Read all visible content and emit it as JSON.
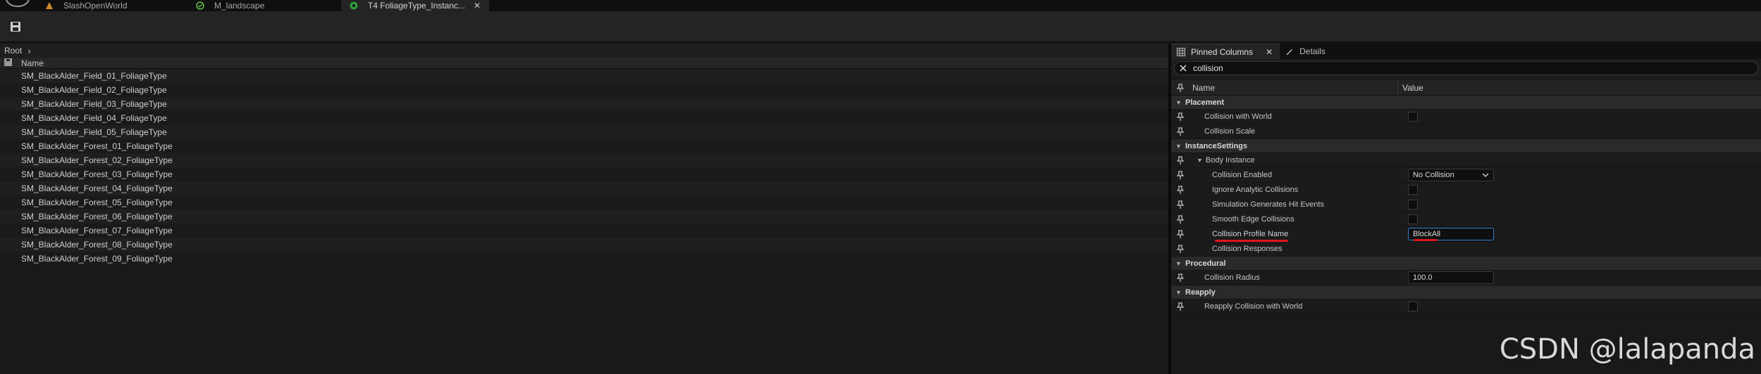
{
  "tabs": [
    {
      "label": "SlashOpenWorld",
      "icon": "level-icon",
      "active": false
    },
    {
      "label": "M_landscape",
      "icon": "material-icon",
      "active": false
    },
    {
      "label": "T4 FoliageType_Instanc...",
      "icon": "foliage-icon",
      "active": true
    }
  ],
  "breadcrumb": {
    "root": "Root"
  },
  "list": {
    "header": "Name",
    "items": [
      "SM_BlackAlder_Field_01_FoliageType",
      "SM_BlackAlder_Field_02_FoliageType",
      "SM_BlackAlder_Field_03_FoliageType",
      "SM_BlackAlder_Field_04_FoliageType",
      "SM_BlackAlder_Field_05_FoliageType",
      "SM_BlackAlder_Forest_01_FoliageType",
      "SM_BlackAlder_Forest_02_FoliageType",
      "SM_BlackAlder_Forest_03_FoliageType",
      "SM_BlackAlder_Forest_04_FoliageType",
      "SM_BlackAlder_Forest_05_FoliageType",
      "SM_BlackAlder_Forest_06_FoliageType",
      "SM_BlackAlder_Forest_07_FoliageType",
      "SM_BlackAlder_Forest_08_FoliageType",
      "SM_BlackAlder_Forest_09_FoliageType"
    ]
  },
  "right_tabs": {
    "pinned": "Pinned Columns",
    "details": "Details"
  },
  "search": {
    "value": "collision"
  },
  "columns": {
    "name": "Name",
    "value": "Value"
  },
  "sections": {
    "placement": "Placement",
    "instance_settings": "InstanceSettings",
    "procedural": "Procedural",
    "reapply": "Reapply"
  },
  "props": {
    "collision_with_world": "Collision with World",
    "collision_scale": "Collision Scale",
    "body_instance": "Body Instance",
    "collision_enabled": "Collision Enabled",
    "collision_enabled_value": "No Collision",
    "ignore_analytic": "Ignore Analytic Collisions",
    "sim_hit_events": "Simulation Generates Hit Events",
    "smooth_edge": "Smooth Edge Collisions",
    "profile_name": "Collision Profile Name",
    "profile_name_value": "BlockAll",
    "collision_responses": "Collision Responses",
    "collision_radius": "Collision Radius",
    "collision_radius_value": "100.0",
    "reapply_collision": "Reapply Collision with World"
  },
  "watermark": "CSDN @lalapanda",
  "colors": {
    "accent": "#2f7fd1",
    "annotation": "#e0141e"
  }
}
